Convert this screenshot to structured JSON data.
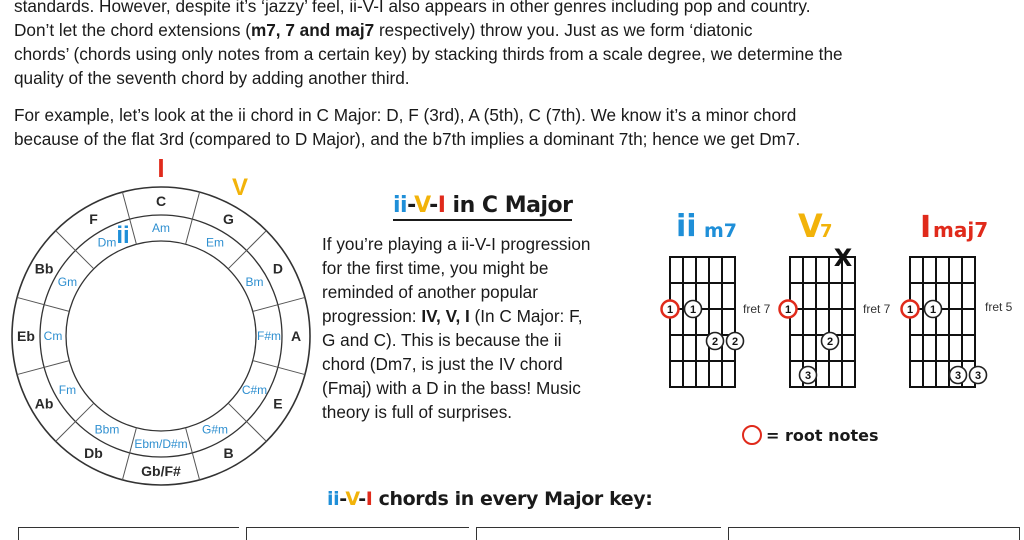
{
  "intro": {
    "p1_lines": [
      "standards.  However, despite it’s ‘jazzy’ feel, ii-V-I also appears in other genres including pop and country.",
      "Don’t let the chord extensions (",
      "m7, 7 and maj7",
      " respectively) throw you.  Just as we form ‘diatonic",
      "chords’ (chords using only notes from a certain key) by stacking thirds from a scale degree, we determine the",
      "quality of the seventh chord by adding another third."
    ],
    "p2_lines": [
      "For example, let’s look at the ii chord in C Major:  D, F (3rd), A (5th), C (7th).   We know it’s a minor chord",
      "because of the flat 3rd (compared to D Major), and the b7th implies a dominant 7th; hence we get Dm7."
    ]
  },
  "circle": {
    "major_keys": [
      "C",
      "G",
      "D",
      "A",
      "E",
      "B",
      "Gb/F#",
      "Db",
      "Ab",
      "Eb",
      "Bb",
      "F"
    ],
    "minor_keys": [
      "Am",
      "Em",
      "Bm",
      "F#m",
      "C#m",
      "G#m",
      "Ebm/D#m",
      "Bbm",
      "Fm",
      "Cm",
      "Gm",
      "Dm"
    ],
    "markers": {
      "I": "I",
      "V": "V",
      "ii": "ii"
    },
    "colors": {
      "red": "#e02a1b",
      "orange": "#f2b30a",
      "blue": "#1f8fd8",
      "minor_text": "#2e8fd0"
    }
  },
  "section": {
    "title_ii": "ii",
    "title_dash1": "-",
    "title_v": "V",
    "title_dash2": "-",
    "title_i": "I",
    "title_rest": " in C Major",
    "side_lines": [
      "If you’re playing a ii-V-I progression",
      "for the first time, you might be",
      "reminded of another popular",
      "progression:  ",
      "IV, V, I",
      " (In C Major:  F,",
      "G and C).  This is because the ii",
      "chord (Dm7, is just the IV chord",
      "(Fmaj) with a D in the bass!  Music",
      "theory is full of surprises."
    ]
  },
  "chord_diagrams": [
    {
      "label_main": "ii",
      "label_ext": "m7",
      "fret": "fret 7"
    },
    {
      "label_main": "V",
      "label_ext": "7",
      "fret": "fret 7",
      "mute": "X"
    },
    {
      "label_main": "I",
      "label_ext": "maj7",
      "fret": "fret 5"
    }
  ],
  "legend": {
    "text": "= root notes"
  },
  "bottom": {
    "title_ii": "ii",
    "title_dash1": "-",
    "title_v": "V",
    "title_dash2": "-",
    "title_i": "I",
    "title_rest": " chords in every Major key:"
  }
}
